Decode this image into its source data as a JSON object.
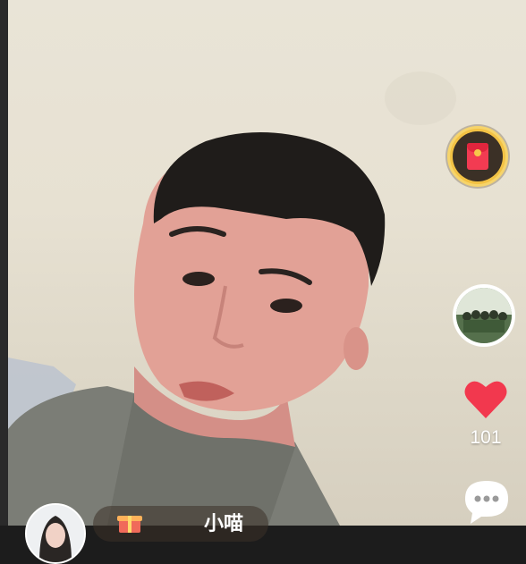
{
  "app": {
    "name": "live-video-viewer"
  },
  "sidebar": {
    "red_packet_icon": "red-envelope-icon",
    "music_disc_icon": "music-disc-icon",
    "like": {
      "icon": "heart-icon",
      "count": "101",
      "color": "#f2384e"
    },
    "comment": {
      "icon": "comment-bubble-icon"
    }
  },
  "bottom_bar": {
    "avatar_icon": "user-avatar",
    "chip": {
      "icon": "gift-icon",
      "label": "小喵"
    }
  },
  "colors": {
    "wall": "#e7e1d2",
    "accent_gold": "#f3c244",
    "heart": "#f2384e"
  }
}
